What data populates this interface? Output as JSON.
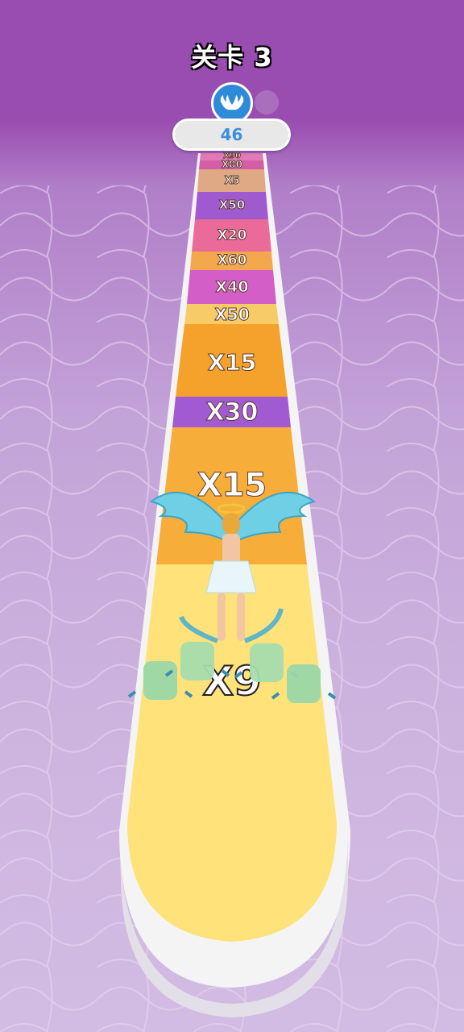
{
  "hud": {
    "level_title": "关卡 3",
    "progress_value": "46"
  },
  "track": {
    "multipliers": [
      "X90",
      "X80",
      "X5",
      "X50",
      "X20",
      "X60",
      "X40",
      "X50",
      "X15",
      "X30",
      "X15",
      "X9"
    ]
  },
  "colors": {
    "sky_top": "#9a4db0",
    "floor": "#cdb4df",
    "track_base": "#ffe27a",
    "badge_blue": "#2f8bd8"
  },
  "icons": [
    "angel-wings-icon"
  ]
}
